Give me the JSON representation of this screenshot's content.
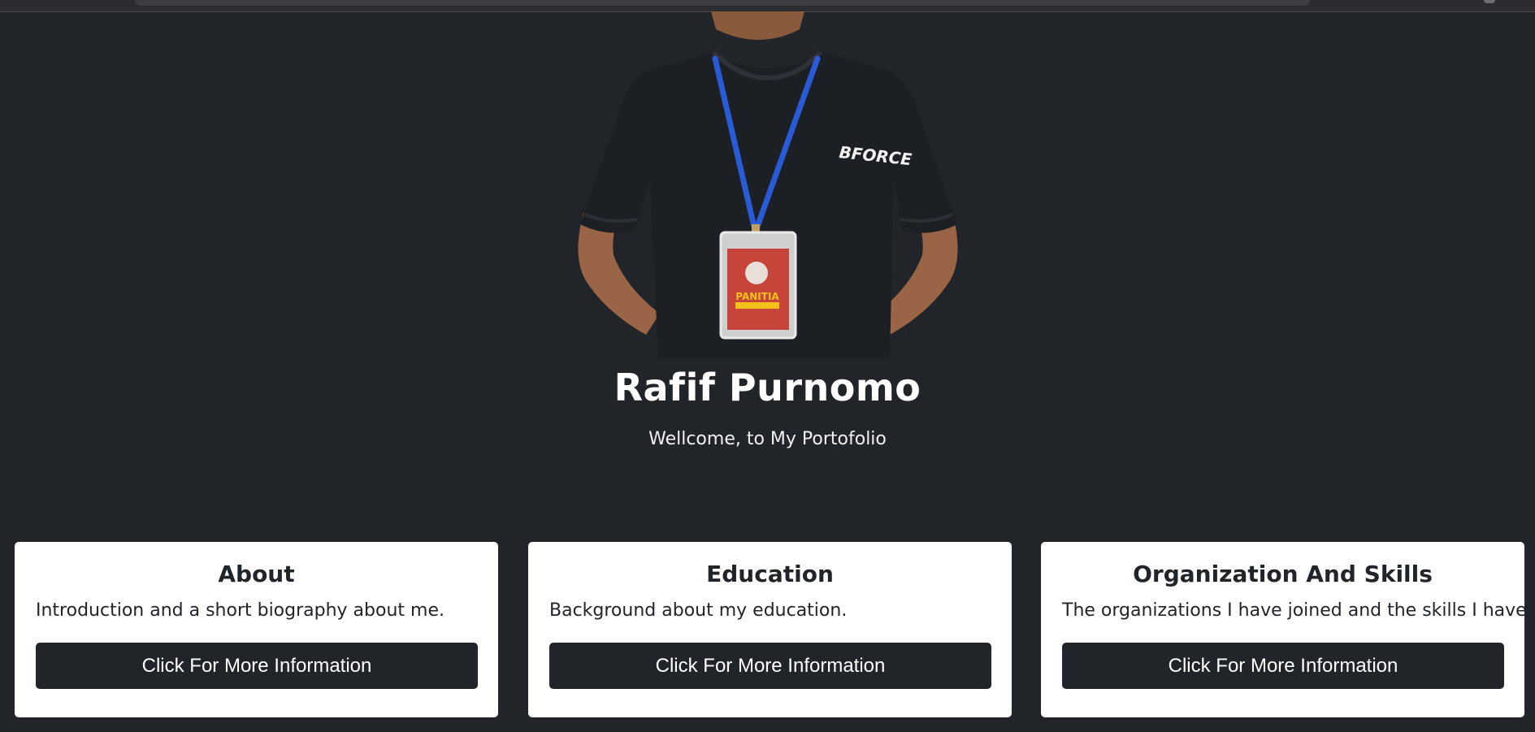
{
  "hero": {
    "name": "Rafif Purnomo",
    "tagline": "Wellcome, to My Portofolio",
    "photo": {
      "shirt_logo": "BFORCE",
      "badge_text": "PANITIA"
    }
  },
  "cards": [
    {
      "title": "About",
      "description": "Introduction and a short biography about me.",
      "button_label": "Click For More Information"
    },
    {
      "title": "Education",
      "description": "Background about my education.",
      "button_label": "Click For More Information"
    },
    {
      "title": "Organization And Skills",
      "description": "The organizations I have joined and the skills I have.",
      "button_label": "Click For More Information"
    }
  ],
  "colors": {
    "background": "#212529",
    "card_background": "#ffffff",
    "button_background": "#212529",
    "text_light": "#ffffff",
    "text_dark": "#212529"
  }
}
